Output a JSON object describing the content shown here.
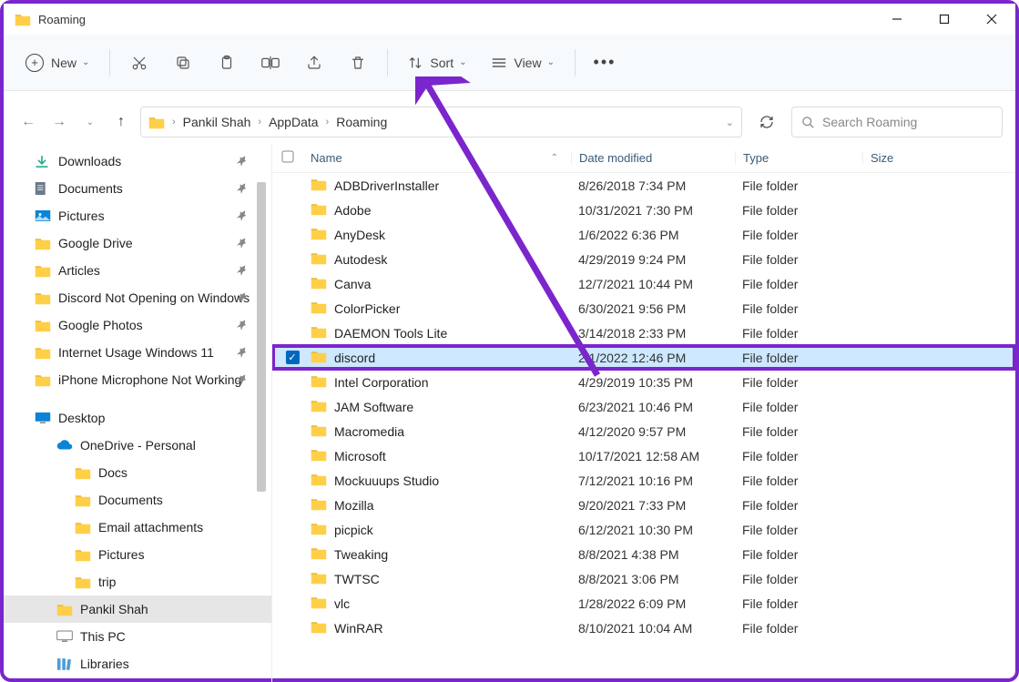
{
  "window": {
    "title": "Roaming"
  },
  "toolbar": {
    "new_label": "New",
    "sort_label": "Sort",
    "view_label": "View"
  },
  "breadcrumb": [
    "Pankil Shah",
    "AppData",
    "Roaming"
  ],
  "search": {
    "placeholder": "Search Roaming"
  },
  "sidebar": {
    "quick": [
      {
        "label": "Downloads",
        "icon": "download",
        "pinned": true
      },
      {
        "label": "Documents",
        "icon": "document",
        "pinned": true
      },
      {
        "label": "Pictures",
        "icon": "pictures",
        "pinned": true
      },
      {
        "label": "Google Drive",
        "icon": "folder",
        "pinned": true
      },
      {
        "label": "Articles",
        "icon": "folder",
        "pinned": true
      },
      {
        "label": "Discord Not Opening on Windows",
        "icon": "folder",
        "pinned": true
      },
      {
        "label": "Google Photos",
        "icon": "folder",
        "pinned": true
      },
      {
        "label": "Internet Usage Windows 11",
        "icon": "folder",
        "pinned": true
      },
      {
        "label": "iPhone Microphone Not Working",
        "icon": "folder",
        "pinned": true
      }
    ],
    "desktop_label": "Desktop",
    "onedrive_label": "OneDrive - Personal",
    "onedrive_children": [
      {
        "label": "Docs"
      },
      {
        "label": "Documents"
      },
      {
        "label": "Email attachments"
      },
      {
        "label": "Pictures"
      },
      {
        "label": "trip"
      }
    ],
    "user_label": "Pankil Shah",
    "thispc_label": "This PC",
    "libraries_label": "Libraries"
  },
  "columns": {
    "name": "Name",
    "date": "Date modified",
    "type": "Type",
    "size": "Size"
  },
  "files": [
    {
      "name": "ADBDriverInstaller",
      "date": "8/26/2018 7:34 PM",
      "type": "File folder"
    },
    {
      "name": "Adobe",
      "date": "10/31/2021 7:30 PM",
      "type": "File folder"
    },
    {
      "name": "AnyDesk",
      "date": "1/6/2022 6:36 PM",
      "type": "File folder"
    },
    {
      "name": "Autodesk",
      "date": "4/29/2019 9:24 PM",
      "type": "File folder"
    },
    {
      "name": "Canva",
      "date": "12/7/2021 10:44 PM",
      "type": "File folder"
    },
    {
      "name": "ColorPicker",
      "date": "6/30/2021 9:56 PM",
      "type": "File folder"
    },
    {
      "name": "DAEMON Tools Lite",
      "date": "3/14/2018 2:33 PM",
      "type": "File folder"
    },
    {
      "name": "discord",
      "date": "2/1/2022 12:46 PM",
      "type": "File folder",
      "selected": true
    },
    {
      "name": "Intel Corporation",
      "date": "4/29/2019 10:35 PM",
      "type": "File folder"
    },
    {
      "name": "JAM Software",
      "date": "6/23/2021 10:46 PM",
      "type": "File folder"
    },
    {
      "name": "Macromedia",
      "date": "4/12/2020 9:57 PM",
      "type": "File folder"
    },
    {
      "name": "Microsoft",
      "date": "10/17/2021 12:58 AM",
      "type": "File folder"
    },
    {
      "name": "Mockuuups Studio",
      "date": "7/12/2021 10:16 PM",
      "type": "File folder"
    },
    {
      "name": "Mozilla",
      "date": "9/20/2021 7:33 PM",
      "type": "File folder"
    },
    {
      "name": "picpick",
      "date": "6/12/2021 10:30 PM",
      "type": "File folder"
    },
    {
      "name": "Tweaking",
      "date": "8/8/2021 4:38 PM",
      "type": "File folder"
    },
    {
      "name": "TWTSC",
      "date": "8/8/2021 3:06 PM",
      "type": "File folder"
    },
    {
      "name": "vlc",
      "date": "1/28/2022 6:09 PM",
      "type": "File folder"
    },
    {
      "name": "WinRAR",
      "date": "8/10/2021 10:04 AM",
      "type": "File folder"
    }
  ]
}
